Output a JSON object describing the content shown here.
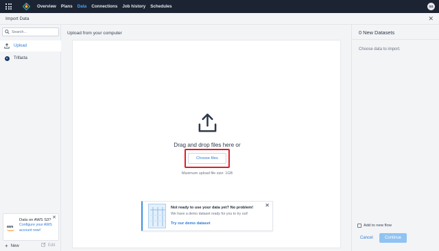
{
  "nav": {
    "items": [
      {
        "label": "Overview",
        "active": false
      },
      {
        "label": "Plans",
        "active": false
      },
      {
        "label": "Data",
        "active": true
      },
      {
        "label": "Connections",
        "active": false
      },
      {
        "label": "Job history",
        "active": false
      },
      {
        "label": "Schedules",
        "active": false
      }
    ],
    "avatar_initials": "SS"
  },
  "header": {
    "title": "Import Data",
    "close_icon": "close-icon"
  },
  "sidebar": {
    "search_placeholder": "Search...",
    "items": [
      {
        "label": "Upload",
        "icon": "upload-icon",
        "active": true
      },
      {
        "label": "Trifacta",
        "icon": "trifacta-icon",
        "active": false
      }
    ],
    "aws_card": {
      "logo_text": "aws",
      "title": "Data on AWS S3?",
      "text": "Configure your AWS account now!"
    },
    "new_label": "New",
    "edit_label": "Edit"
  },
  "main": {
    "title": "Upload from your computer",
    "drag_text": "Drag and drop files here or",
    "choose_button": "Choose files",
    "max_size": "Maximum upload file size: 1GB",
    "demo": {
      "title": "Not ready to use your data yet? No problem!",
      "subtitle": "We have a demo dataset ready for you to try out!",
      "link": "Try our demo dataset"
    }
  },
  "right_panel": {
    "title": "0 New Datasets",
    "hint": "Choose data to import.",
    "add_to_flow_label": "Add to new flow",
    "add_to_flow_checked": false,
    "cancel_label": "Cancel",
    "continue_label": "Continue"
  },
  "colors": {
    "nav_bg": "#1c2433",
    "accent": "#2b7bd6",
    "active_nav": "#4aa3ff",
    "highlight_frame": "#e01b24",
    "continue_disabled": "#8fc3f2"
  }
}
